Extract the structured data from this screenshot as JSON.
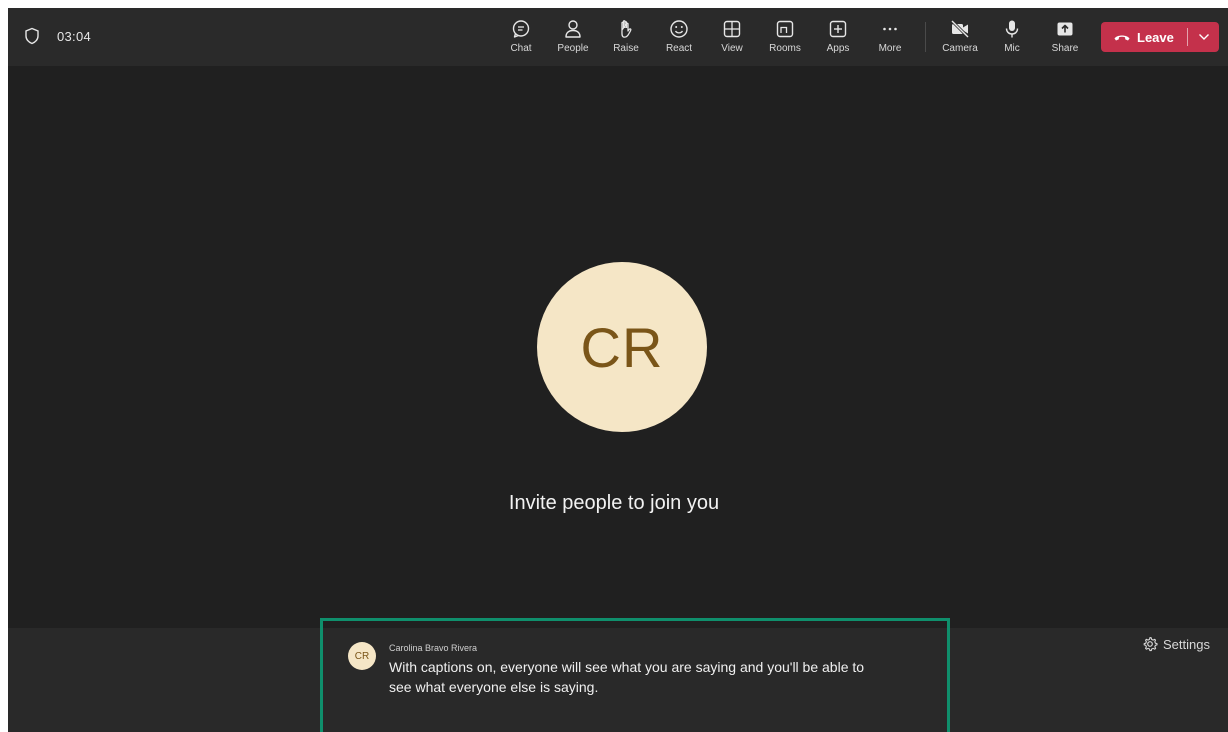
{
  "meeting": {
    "timer": "03:04"
  },
  "toolbar": {
    "chat": "Chat",
    "people": "People",
    "raise": "Raise",
    "react": "React",
    "view": "View",
    "rooms": "Rooms",
    "apps": "Apps",
    "more": "More",
    "camera": "Camera",
    "mic": "Mic",
    "share": "Share",
    "leave": "Leave"
  },
  "stage": {
    "avatar_initials": "CR",
    "invite_text": "Invite people to join you"
  },
  "caption": {
    "avatar_initials": "CR",
    "speaker": "Carolina Bravo Rivera",
    "text": "With captions on, everyone will see what you are saying and you'll be able to see what everyone else is saying."
  },
  "captions_panel": {
    "settings_label": "Settings"
  },
  "colors": {
    "background": "#202020",
    "topbar": "#2a2a2a",
    "leave_button": "#c4314b",
    "avatar_fill": "#f5e6c6",
    "avatar_text": "#7a5518",
    "caption_highlight": "#0f8f6c"
  },
  "icons": [
    "shield-icon",
    "chat-icon",
    "people-icon",
    "raise-hand-icon",
    "react-icon",
    "view-icon",
    "rooms-icon",
    "apps-icon",
    "more-icon",
    "camera-off-icon",
    "mic-icon",
    "share-icon",
    "phone-icon",
    "chevron-down-icon",
    "settings-gear-icon"
  ]
}
